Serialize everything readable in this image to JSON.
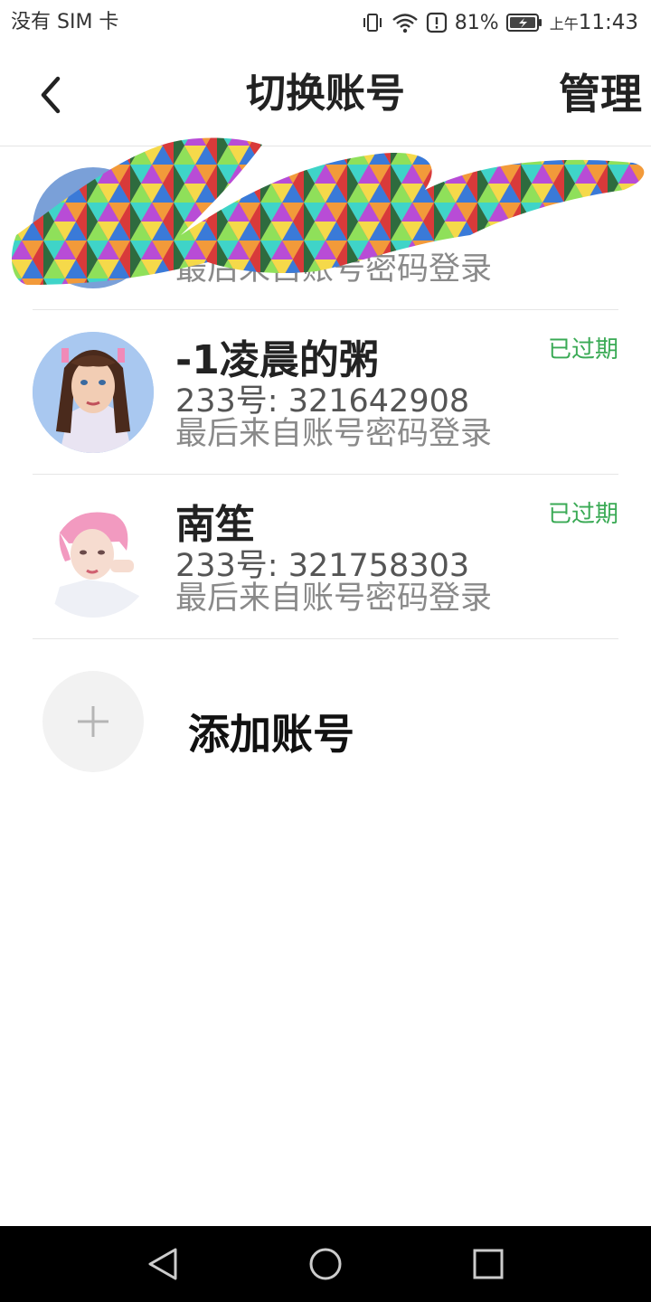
{
  "status_bar": {
    "carrier": "没有 SIM 卡",
    "battery_percent": "81%",
    "time_prefix": "上午",
    "time": "11:43"
  },
  "header": {
    "title": "切换账号",
    "manage_label": "管理",
    "back_icon": "chevron-left-icon"
  },
  "accounts": [
    {
      "name": "",
      "login_method": "最后来自账号密码登录",
      "redacted": true
    },
    {
      "name": "-1凌晨的粥",
      "id_text": "233号: 321642908",
      "login_method": "最后来自账号密码登录",
      "status": "已过期"
    },
    {
      "name": "南笙",
      "id_text": "233号: 321758303",
      "login_method": "最后来自账号密码登录",
      "status": "已过期"
    }
  ],
  "add_account": {
    "label": "添加账号",
    "icon": "plus-icon"
  },
  "colors": {
    "expired_status": "#3aaa55",
    "title_text": "#222222",
    "secondary_text": "#8a8a8a"
  },
  "nav_bar": {
    "back": "triangle-back-icon",
    "home": "circle-home-icon",
    "recents": "square-recents-icon"
  }
}
